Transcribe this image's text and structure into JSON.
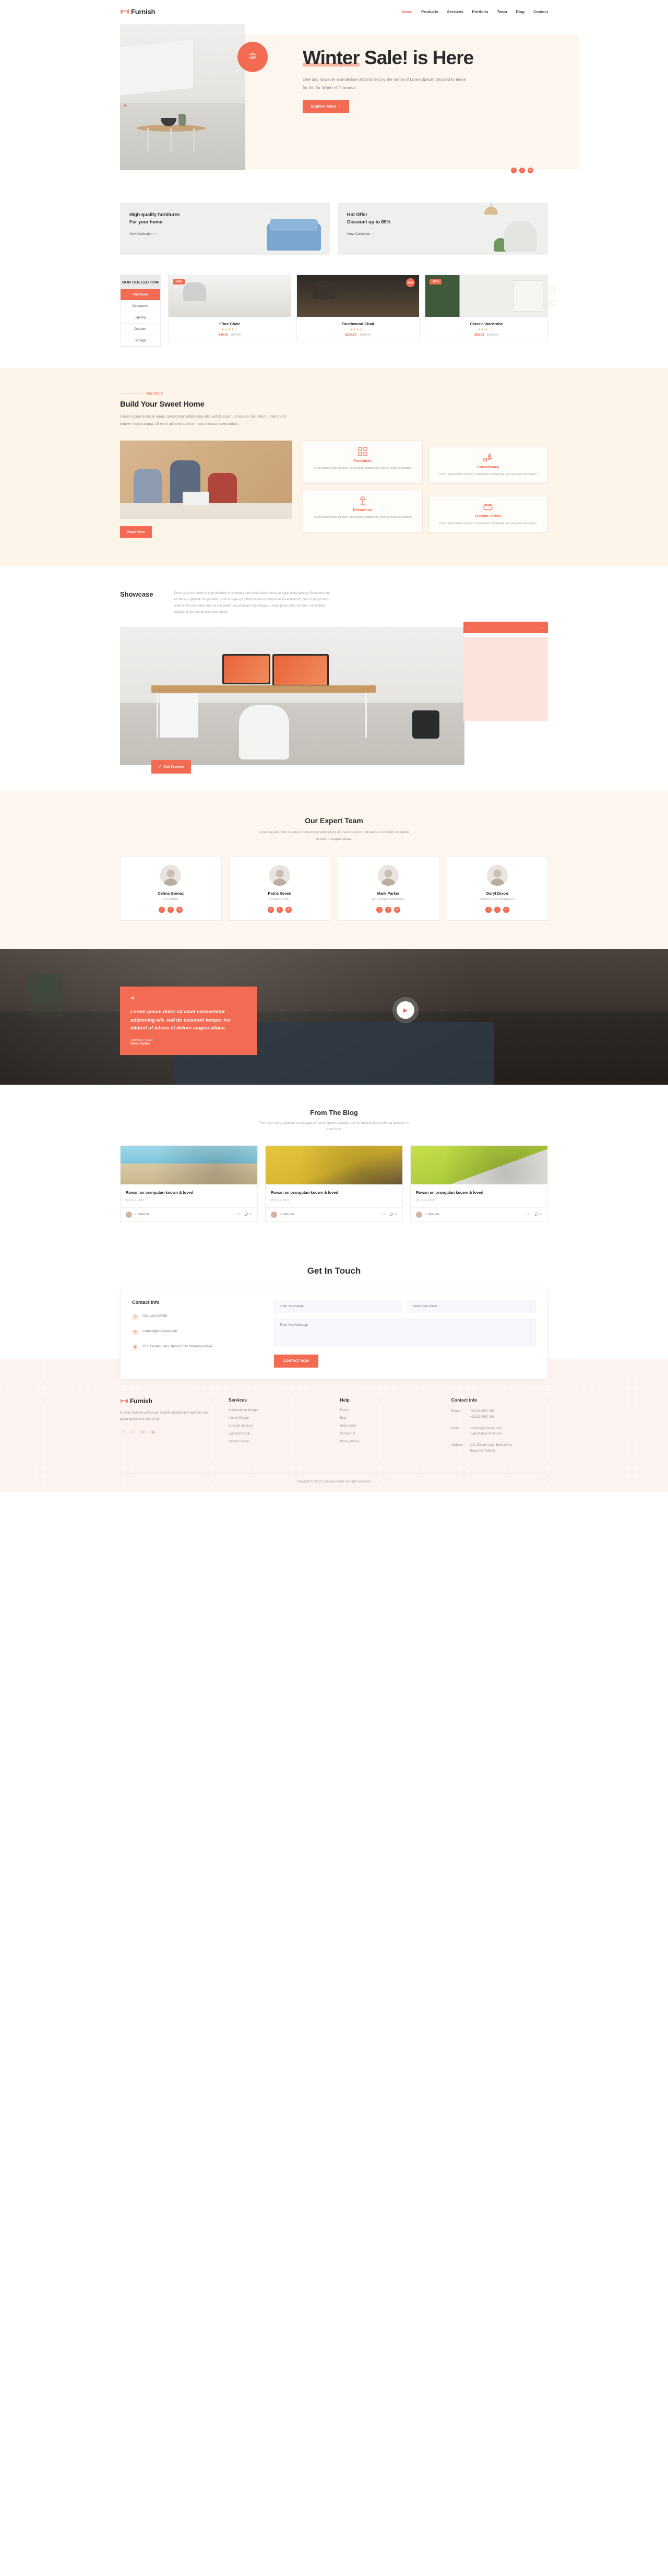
{
  "brand": {
    "name": "Furnish",
    "logo_icon": "chair-logo-icon"
  },
  "nav": {
    "items": [
      {
        "label": "Home",
        "active": true
      },
      {
        "label": "Products",
        "active": false
      },
      {
        "label": "Services",
        "active": false
      },
      {
        "label": "Portfolio",
        "active": false
      },
      {
        "label": "Team",
        "active": false
      },
      {
        "label": "Blog",
        "active": false
      },
      {
        "label": "Contact",
        "active": false
      }
    ]
  },
  "hero": {
    "badge_line1": "50%",
    "badge_line2": "OFF",
    "title_underlined": "Winter",
    "title_rest": " Sale! is Here",
    "paragraph": "One day however a small line of blind text by the name of Lorem Ipsum decided to leave for the far World of Grammar.",
    "cta": "Explore More",
    "cta_icon": "chevron-right-icon",
    "socials": [
      "f",
      "t",
      "in"
    ],
    "colors": {
      "accent": "#f26b52",
      "cream": "#fdf6ef"
    }
  },
  "promos": [
    {
      "line1": "High-quality furnitures",
      "line2": "For your home",
      "link": "View Collection"
    },
    {
      "line1": "Hot Offer",
      "line2": "Discount up to 80%",
      "link": "View Collection"
    }
  ],
  "collection": {
    "title": "OUR COLLECTION",
    "categories": [
      {
        "label": "Furniture",
        "active": true
      },
      {
        "label": "Decorative",
        "active": false
      },
      {
        "label": "Lighting",
        "active": false
      },
      {
        "label": "Outdoor",
        "active": false
      },
      {
        "label": "Storage",
        "active": false
      }
    ],
    "products": [
      {
        "name": "Fibre Chair",
        "badge": "-40%",
        "badge_shape": "pill",
        "rating": 4,
        "price": "$49.00",
        "old_price": "$69.00"
      },
      {
        "name": "Touchwood Chair",
        "badge": "Sale",
        "badge_shape": "round",
        "rating": 4,
        "price": "$129.00",
        "old_price": "$159.00"
      },
      {
        "name": "Classic Wardrobe",
        "badge": "-30%",
        "badge_shape": "pill",
        "rating": 3,
        "price": "$89.00",
        "old_price": "$129.00"
      }
    ],
    "prev_icon": "chevron-left-icon",
    "next_icon": "chevron-right-icon"
  },
  "story": {
    "eyebrow": "Our Story",
    "title": "Build Your Sweet Home",
    "lead": "Lorem ipsum dolor sit amet, consectetur adipisicing elit, sed do eiusm od tempor incididunt ut labore et dolore magna aliqua. Ut enim ad minim veniam, quis nostrud exercitation.",
    "button": "Read More",
    "features": [
      {
        "title": "Furnitures",
        "icon": "grid-squares-icon",
        "text": "Lorem ipsum dolor sit amet, consectetur adipisicing, sed do eiusm od tempor."
      },
      {
        "title": "Consultancy",
        "icon": "hand-box-icon",
        "text": "Lorem ipsum dolor sit amet, consectetur adipisicing, sed do eiusm od tempor."
      },
      {
        "title": "Decoration",
        "icon": "lamp-icon",
        "text": "Lorem ipsum dolor sit amet, consectetur adipisicing, sed do eiusm od tempor."
      },
      {
        "title": "Custom Orders",
        "icon": "sofa-icon",
        "text": "Lorem ipsum dolor sit amet, consectetur adipisicing, sed do eiusm od tempor."
      }
    ]
  },
  "showcase": {
    "title": "Showcase",
    "paragraph": "Dolor sit a muro dolor is imprehenderit in voluptate velit esse cillum dolore eu fugiat nulla pariatur. Excepteur sint occaecat cupidatat non proident, sunt in culpa qui officia deserunt mollit anim id est laborum. Sed ut perspiciatis unde omnis iste natus error sit voluptatem accusantium doloremque, Lorem ipsum dolor sit amet, consectetur adipiscing elit, sed do eiusmod tempor.",
    "prev_icon": "chevron-left-icon",
    "next_icon": "chevron-right-icon",
    "preview_button": "Full Preview",
    "preview_icon": "external-link-icon"
  },
  "team": {
    "title": "Our Expert Team",
    "subtitle": "Lorem ipsum dolor sit amet, consectetur adipisicing elit, sed do eiusm od tempor incididunt ut labore et dolore magna aliqua.",
    "members": [
      {
        "name": "Celina Gomez",
        "role": "FOUNDER"
      },
      {
        "name": "Patric Green",
        "role": "CONSULTANT"
      },
      {
        "name": "Mark Parker",
        "role": "BUSINESS MANAGER"
      },
      {
        "name": "Daryl Dixon",
        "role": "MARKETING MANAGER"
      }
    ],
    "socials": [
      "f",
      "t",
      "in"
    ]
  },
  "testimonial": {
    "quote_icon": "quote-icon",
    "text": "Lorem ipsum dolor sit amet consectetur adipiscing elit, sed do eiusmod tempor inc ididunt ut labore et dolore magna aliqua.",
    "author_label": "Rating 5.0 (4.5/5)",
    "author": "Elina Parker",
    "play_icon": "play-icon"
  },
  "blog": {
    "title": "From The Blog",
    "subtitle": "There are many variations of passages of Lorem Ipsum available, but the majority have suffered alteration in some form.",
    "posts": [
      {
        "title": "Rowan an orangutan known & loved",
        "date": "26 JULY, 2022",
        "author": "J. PARKER",
        "likes": "12",
        "comments": "08"
      },
      {
        "title": "Rowan an orangutan known & loved",
        "date": "26 JULY, 2022",
        "author": "J. PARKER",
        "likes": "12",
        "comments": "08"
      },
      {
        "title": "Rowan an orangutan known & loved",
        "date": "26 JULY, 2022",
        "author": "J. PARKER",
        "likes": "12",
        "comments": "08"
      }
    ],
    "like_icon": "heart-icon",
    "comment_icon": "comment-icon"
  },
  "contact": {
    "title": "Get In Touch",
    "info_title": "Contact Info",
    "phone": "+88 1234 56789",
    "phone_icon": "phone-icon",
    "email": "contact@yourmail.com",
    "email_icon": "mail-icon",
    "address": "203, Envato Labs, Behind Sits Street,Australia",
    "address_icon": "location-pin-icon",
    "form": {
      "name_placeholder": "Enter Your Name",
      "email_placeholder": "Enter Your Email",
      "message_placeholder": "Enter Your Message",
      "submit": "CONTACT NOW"
    }
  },
  "footer": {
    "brand": "Furnish",
    "about": "Gravida nibh vel velit auctor aliquetn quibibendum auci elit cons equat ipsutis sem nibh id elit.",
    "socials": [
      "f",
      "t",
      "in",
      "ig"
    ],
    "columns": [
      {
        "title": "Services",
        "items": [
          "Architechture Design",
          "Interior Design",
          "Autocad Services",
          "Lighting Design",
          "Painter Design"
        ]
      },
      {
        "title": "Help",
        "items": [
          "Forum",
          "Blog",
          "Help Center",
          "Contact Us",
          "Privacy Policy"
        ]
      }
    ],
    "contact_title": "Contact Info",
    "contact_rows": [
      {
        "label": "Phone :",
        "values": [
          "+88123 4567 890",
          "+88123 4567 890"
        ]
      },
      {
        "label": "Email :",
        "values": [
          "contact@yourmail.com",
          "support@yourmail.com"
        ]
      },
      {
        "label": "Address :",
        "values": [
          "203, Envato Labs, Behind Sits",
          "Road, NY 725105"
        ]
      }
    ],
    "copyright": "Copyright © 2022 Company Name All rights reserved."
  }
}
